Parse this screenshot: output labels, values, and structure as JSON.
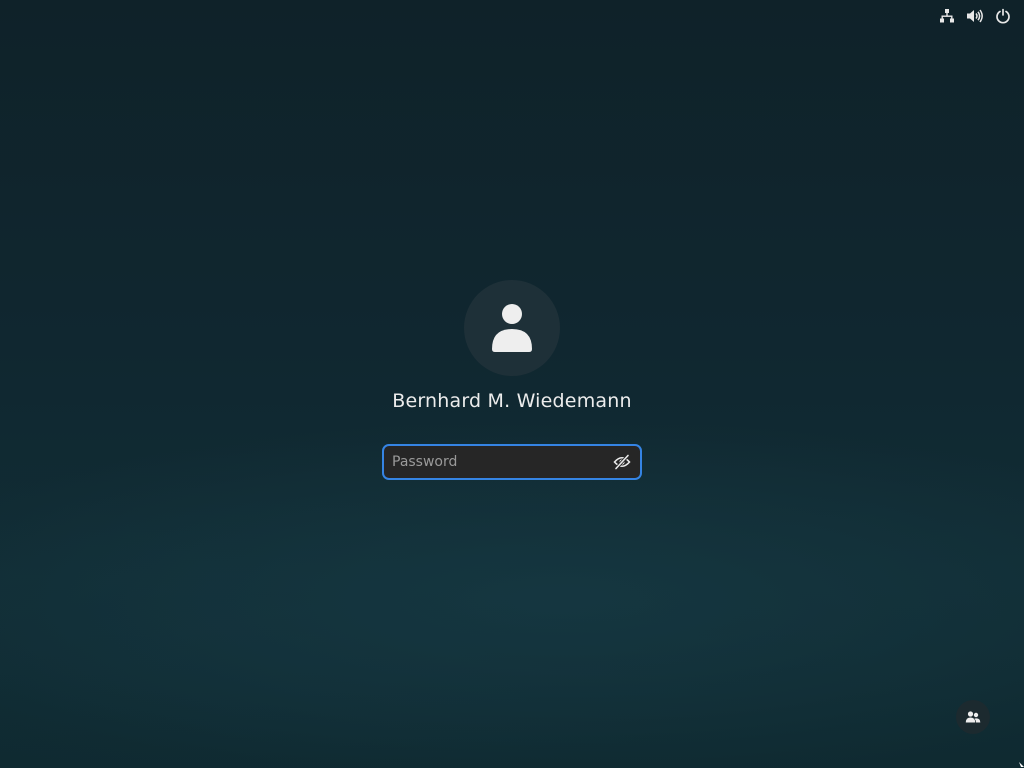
{
  "topbar": {
    "icons": [
      "network-icon",
      "volume-icon",
      "power-icon"
    ]
  },
  "login": {
    "user_name": "Bernhard M. Wiedemann",
    "password": {
      "placeholder": "Password",
      "value": ""
    },
    "avatar_icon": "user-icon",
    "reveal_icon": "eye-slash-icon"
  },
  "bottom": {
    "switch_user_icon": "users-icon"
  },
  "colors": {
    "accent": "#3584e4",
    "background_top": "#0f2229",
    "background_bottom": "#112d35",
    "avatar_bg": "#1e3038",
    "entry_bg": "#262626"
  }
}
